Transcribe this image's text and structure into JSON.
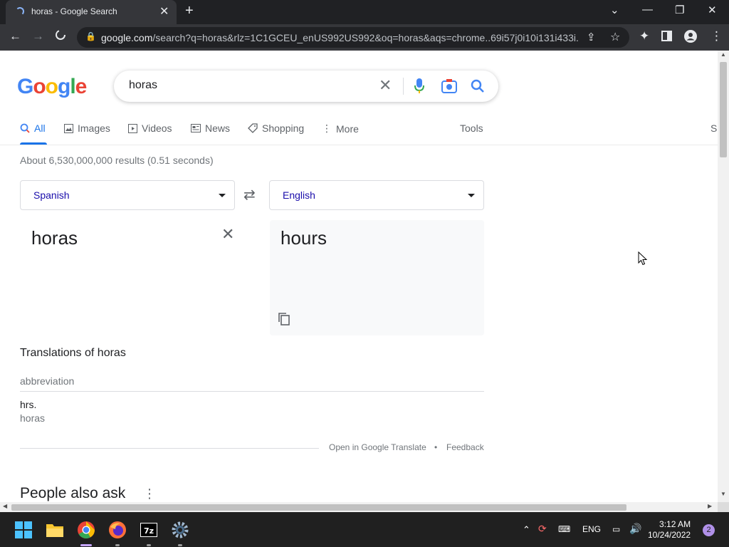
{
  "browser": {
    "tab_title": "horas - Google Search",
    "url_host": "google.com",
    "url_rest": "/search?q=horas&rlz=1C1GCEU_enUS992US992&oq=horas&aqs=chrome..69i57j0i10i131i433i..."
  },
  "search": {
    "logo": [
      "G",
      "o",
      "o",
      "g",
      "l",
      "e"
    ],
    "logo_colors": [
      "#4285f4",
      "#ea4335",
      "#fbbc05",
      "#4285f4",
      "#34a853",
      "#ea4335"
    ],
    "query": "horas",
    "stats": "About 6,530,000,000 results (0.51 seconds)"
  },
  "nav": {
    "all": "All",
    "images": "Images",
    "videos": "Videos",
    "news": "News",
    "shopping": "Shopping",
    "more": "More",
    "tools": "Tools",
    "edge_s": "S"
  },
  "translator": {
    "source_lang": "Spanish",
    "target_lang": "English",
    "source_text": "horas",
    "target_text": "hours",
    "translations_heading": "Translations of horas",
    "part_of_speech": "abbreviation",
    "translation_word": "hrs.",
    "back_translation": "horas",
    "open_link": "Open in Google Translate",
    "bullet": "•",
    "feedback": "Feedback"
  },
  "people_also_ask": "People also ask",
  "taskbar": {
    "language": "ENG",
    "time": "3:12 AM",
    "date": "10/24/2022",
    "notifications": "2"
  },
  "colors": {
    "accent": "#1a73e8",
    "link": "#1a0dab",
    "chrome_dark": "#202124",
    "chrome_toolbar": "#35363a"
  }
}
